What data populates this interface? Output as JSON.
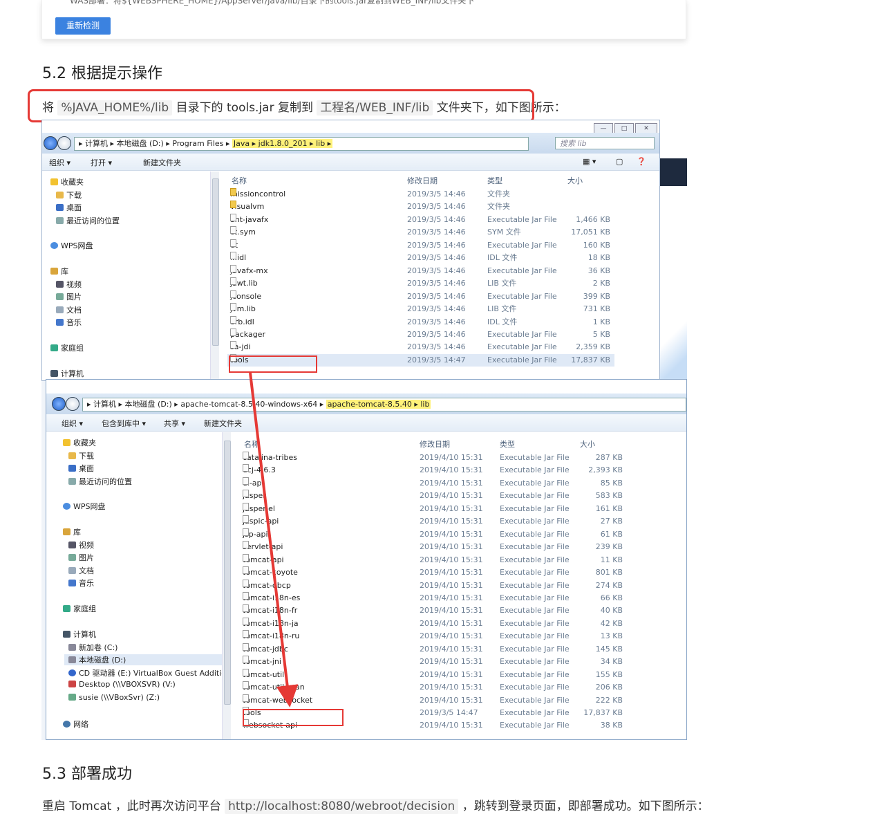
{
  "top_card": {
    "cut_text": "WAS部署：将${WEBSPHERE_HOME}/AppServer/java/lib/目录下的tools.jar复制到WEB_INF/lib文件夹下",
    "recheck_button": "重新检测"
  },
  "section_52": {
    "title": "5.2 根据提示操作",
    "p_prefix": "将",
    "code1": "%JAVA_HOME%/lib",
    "p_mid1": "目录下的 tools.jar 复制到",
    "code2": "工程名/WEB_INF/lib",
    "p_mid2": "文件夹下，如下图所示："
  },
  "section_53": {
    "title": "5.3 部署成功",
    "p_prefix": "重启 Tomcat ，此时再次访问平台",
    "code1": "http://localhost:8080/webroot/decision",
    "p_suffix": "，跳转到登录页面，即部署成功。如下图所示："
  },
  "win1": {
    "crumbs": [
      "计算机",
      "本地磁盘 (D:)",
      "Program Files"
    ],
    "crumbs_hl": [
      "Java",
      "jdk1.8.0_201",
      "lib"
    ],
    "search_placeholder": "搜索 lib",
    "toolbar": [
      "组织 ▾",
      "打开 ▾",
      "新建文件夹"
    ],
    "sidebar": [
      "收藏夹",
      "下载",
      "桌面",
      "最近访问的位置",
      "WPS网盘",
      "库",
      "视频",
      "图片",
      "文档",
      "音乐",
      "家庭组",
      "计算机"
    ],
    "headers": [
      "名称",
      "修改日期",
      "类型",
      "大小"
    ],
    "rows": [
      [
        "missioncontrol",
        "2019/3/5 14:46",
        "文件夹",
        ""
      ],
      [
        "visualvm",
        "2019/3/5 14:46",
        "文件夹",
        ""
      ],
      [
        "ant-javafx",
        "2019/3/5 14:46",
        "Executable Jar File",
        "1,466 KB"
      ],
      [
        "ct.sym",
        "2019/3/5 14:46",
        "SYM 文件",
        "17,051 KB"
      ],
      [
        "dt",
        "2019/3/5 14:46",
        "Executable Jar File",
        "160 KB"
      ],
      [
        "ir.idl",
        "2019/3/5 14:46",
        "IDL 文件",
        "18 KB"
      ],
      [
        "javafx-mx",
        "2019/3/5 14:46",
        "Executable Jar File",
        "36 KB"
      ],
      [
        "jawt.lib",
        "2019/3/5 14:46",
        "LIB 文件",
        "2 KB"
      ],
      [
        "jconsole",
        "2019/3/5 14:46",
        "Executable Jar File",
        "399 KB"
      ],
      [
        "jvm.lib",
        "2019/3/5 14:46",
        "LIB 文件",
        "731 KB"
      ],
      [
        "orb.idl",
        "2019/3/5 14:46",
        "IDL 文件",
        "1 KB"
      ],
      [
        "packager",
        "2019/3/5 14:46",
        "Executable Jar File",
        "5 KB"
      ],
      [
        "sa-jdi",
        "2019/3/5 14:46",
        "Executable Jar File",
        "2,359 KB"
      ],
      [
        "tools",
        "2019/3/5 14:47",
        "Executable Jar File",
        "17,837 KB"
      ]
    ]
  },
  "win2": {
    "crumbs": [
      "计算机",
      "本地磁盘 (D:)",
      "apache-tomcat-8.5.40-windows-x64"
    ],
    "crumbs_hl": [
      "apache-tomcat-8.5.40",
      "lib"
    ],
    "toolbar": [
      "组织 ▾",
      "包含到库中 ▾",
      "共享 ▾",
      "新建文件夹"
    ],
    "sidebar": [
      "收藏夹",
      "下载",
      "桌面",
      "最近访问的位置",
      "WPS网盘",
      "库",
      "视频",
      "图片",
      "文档",
      "音乐",
      "家庭组",
      "计算机",
      "新加卷 (C:)",
      "本地磁盘 (D:)",
      "CD 驱动器 (E:) VirtualBox Guest Addition",
      "Desktop (\\\\VBOXSVR) (V:)",
      "susie (\\\\VBoxSvr) (Z:)",
      "网络"
    ],
    "headers": [
      "名称",
      "修改日期",
      "类型",
      "大小"
    ],
    "rows": [
      [
        "catalina-tribes",
        "2019/4/10 15:31",
        "Executable Jar File",
        "287 KB"
      ],
      [
        "ecj-4.6.3",
        "2019/4/10 15:31",
        "Executable Jar File",
        "2,393 KB"
      ],
      [
        "el-api",
        "2019/4/10 15:31",
        "Executable Jar File",
        "85 KB"
      ],
      [
        "jasper",
        "2019/4/10 15:31",
        "Executable Jar File",
        "583 KB"
      ],
      [
        "jasper-el",
        "2019/4/10 15:31",
        "Executable Jar File",
        "161 KB"
      ],
      [
        "jaspic-api",
        "2019/4/10 15:31",
        "Executable Jar File",
        "27 KB"
      ],
      [
        "jsp-api",
        "2019/4/10 15:31",
        "Executable Jar File",
        "61 KB"
      ],
      [
        "servlet-api",
        "2019/4/10 15:31",
        "Executable Jar File",
        "239 KB"
      ],
      [
        "tomcat-api",
        "2019/4/10 15:31",
        "Executable Jar File",
        "11 KB"
      ],
      [
        "tomcat-coyote",
        "2019/4/10 15:31",
        "Executable Jar File",
        "801 KB"
      ],
      [
        "tomcat-dbcp",
        "2019/4/10 15:31",
        "Executable Jar File",
        "274 KB"
      ],
      [
        "tomcat-i18n-es",
        "2019/4/10 15:31",
        "Executable Jar File",
        "66 KB"
      ],
      [
        "tomcat-i18n-fr",
        "2019/4/10 15:31",
        "Executable Jar File",
        "40 KB"
      ],
      [
        "tomcat-i18n-ja",
        "2019/4/10 15:31",
        "Executable Jar File",
        "42 KB"
      ],
      [
        "tomcat-i18n-ru",
        "2019/4/10 15:31",
        "Executable Jar File",
        "13 KB"
      ],
      [
        "tomcat-jdbc",
        "2019/4/10 15:31",
        "Executable Jar File",
        "145 KB"
      ],
      [
        "tomcat-jni",
        "2019/4/10 15:31",
        "Executable Jar File",
        "34 KB"
      ],
      [
        "tomcat-util",
        "2019/4/10 15:31",
        "Executable Jar File",
        "155 KB"
      ],
      [
        "tomcat-util-scan",
        "2019/4/10 15:31",
        "Executable Jar File",
        "206 KB"
      ],
      [
        "tomcat-websocket",
        "2019/4/10 15:31",
        "Executable Jar File",
        "222 KB"
      ],
      [
        "tools",
        "2019/3/5 14:47",
        "Executable Jar File",
        "17,837 KB"
      ],
      [
        "websocket-api",
        "2019/4/10 15:31",
        "Executable Jar File",
        "38 KB"
      ]
    ]
  },
  "colors": {
    "highlight_red": "#e53935",
    "button_blue": "#3b82e0",
    "crumb_highlight": "#fff27a"
  }
}
